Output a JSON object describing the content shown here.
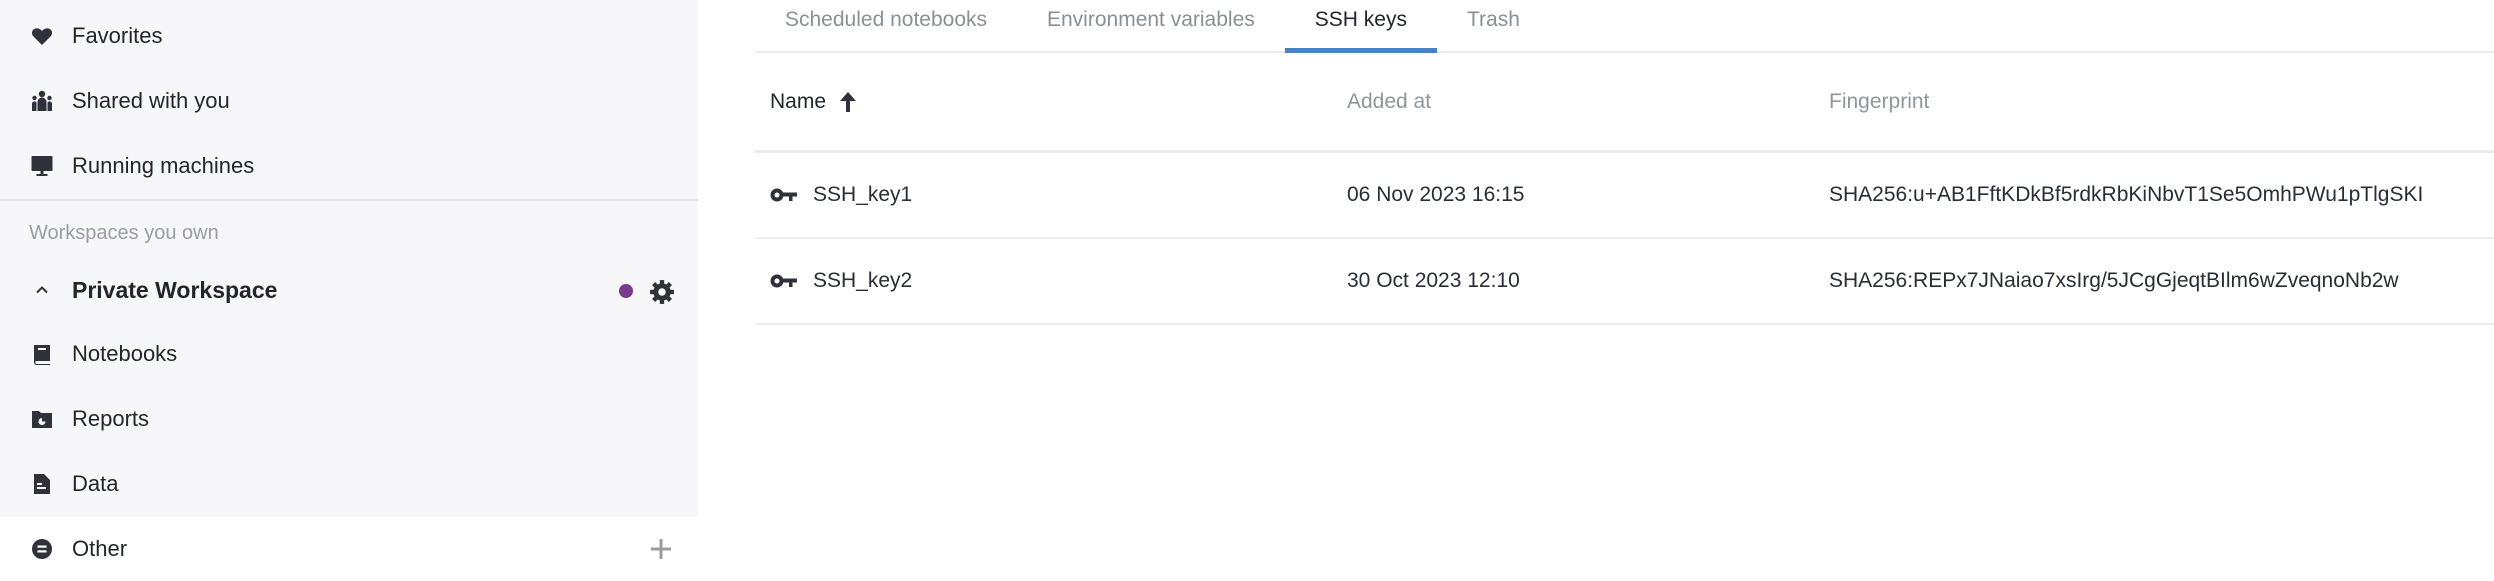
{
  "sidebar": {
    "items": [
      {
        "label": "Favorites",
        "icon": "heart-icon"
      },
      {
        "label": "Shared with you",
        "icon": "users-icon"
      },
      {
        "label": "Running machines",
        "icon": "monitor-icon"
      }
    ],
    "section_label": "Workspaces you own",
    "workspace": {
      "title": "Private Workspace",
      "status_dot_color": "#7b3b8c",
      "items": [
        {
          "label": "Notebooks",
          "icon": "book-icon"
        },
        {
          "label": "Reports",
          "icon": "report-folder-icon"
        },
        {
          "label": "Data",
          "icon": "file-icon"
        }
      ]
    },
    "other": {
      "label": "Other",
      "icon": "other-circle-icon"
    }
  },
  "tabs": [
    {
      "label": "Scheduled notebooks",
      "active": false
    },
    {
      "label": "Environment variables",
      "active": false
    },
    {
      "label": "SSH keys",
      "active": true
    },
    {
      "label": "Trash",
      "active": false
    }
  ],
  "accent_color": "#4a80c8",
  "table": {
    "columns": {
      "name": "Name",
      "added_at": "Added at",
      "fingerprint": "Fingerprint"
    },
    "sort": {
      "column": "Name",
      "direction": "ascending"
    },
    "rows": [
      {
        "name": "SSH_key1",
        "added_at": "06 Nov 2023 16:15",
        "fingerprint": "SHA256:u+AB1FftKDkBf5rdkRbKiNbvT1Se5OmhPWu1pTlgSKI"
      },
      {
        "name": "SSH_key2",
        "added_at": "30 Oct 2023 12:10",
        "fingerprint": "SHA256:REPx7JNaiao7xsIrg/5JCgGjeqtBIlm6wZveqnoNb2w"
      }
    ]
  }
}
